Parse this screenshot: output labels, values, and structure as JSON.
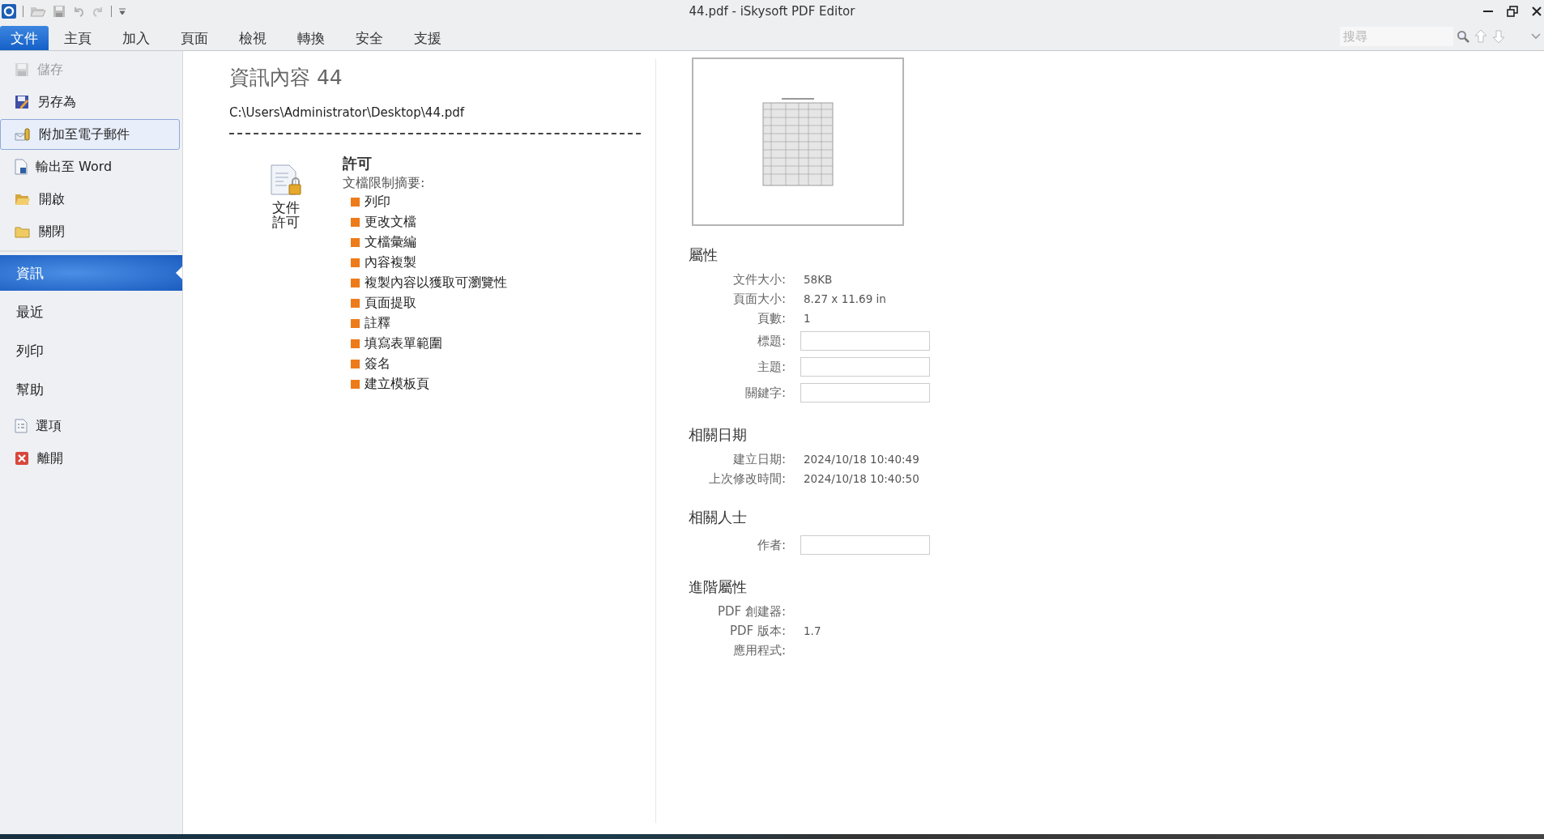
{
  "window": {
    "title": "44.pdf - iSkysoft PDF Editor"
  },
  "menu_tabs": [
    {
      "label": "文件",
      "selected": true
    },
    {
      "label": "主頁",
      "selected": false
    },
    {
      "label": "加入",
      "selected": false
    },
    {
      "label": "頁面",
      "selected": false
    },
    {
      "label": "檢視",
      "selected": false
    },
    {
      "label": "轉換",
      "selected": false
    },
    {
      "label": "安全",
      "selected": false
    },
    {
      "label": "支援",
      "selected": false
    }
  ],
  "search": {
    "placeholder": "搜尋"
  },
  "sidebar": {
    "items": [
      {
        "kind": "command",
        "label": "儲存",
        "disabled": true,
        "highlighted": false
      },
      {
        "kind": "command",
        "label": "另存為",
        "disabled": false,
        "highlighted": false
      },
      {
        "kind": "command",
        "label": "附加至電子郵件",
        "disabled": false,
        "highlighted": true
      },
      {
        "kind": "command",
        "label": "輸出至 Word",
        "disabled": false,
        "highlighted": false
      },
      {
        "kind": "command",
        "label": "開啟",
        "disabled": false,
        "highlighted": false
      },
      {
        "kind": "command",
        "label": "關閉",
        "disabled": false,
        "highlighted": false
      },
      {
        "kind": "nav",
        "label": "資訊",
        "selected": true
      },
      {
        "kind": "nav",
        "label": "最近",
        "selected": false
      },
      {
        "kind": "nav",
        "label": "列印",
        "selected": false
      },
      {
        "kind": "nav",
        "label": "幫助",
        "selected": false
      },
      {
        "kind": "command",
        "label": "選項",
        "disabled": false,
        "highlighted": false
      },
      {
        "kind": "command",
        "label": "離開",
        "disabled": false,
        "highlighted": false
      }
    ]
  },
  "info": {
    "title": "資訊內容 44",
    "path": "C:\\Users\\Administrator\\Desktop\\44.pdf",
    "permission_button": "文件許可",
    "permissions": {
      "heading": "許可",
      "subtitle": "文檔限制摘要:",
      "items": [
        "列印",
        "更改文檔",
        "文檔彙編",
        "內容複製",
        "複製內容以獲取可瀏覽性",
        "頁面提取",
        "註釋",
        "填寫表單範圍",
        "簽名",
        "建立模板頁"
      ]
    }
  },
  "properties": {
    "sections": [
      {
        "heading": "屬性",
        "rows": [
          {
            "kind": "text",
            "label": "文件大小:",
            "value": "58KB"
          },
          {
            "kind": "text",
            "label": "頁面大小:",
            "value": "8.27 x 11.69 in"
          },
          {
            "kind": "text",
            "label": "頁數:",
            "value": "1"
          },
          {
            "kind": "field",
            "label": "標題:"
          },
          {
            "kind": "field",
            "label": "主題:"
          },
          {
            "kind": "field",
            "label": "關鍵字:"
          }
        ]
      },
      {
        "heading": "相關日期",
        "rows": [
          {
            "kind": "text",
            "label": "建立日期:",
            "value": "2024/10/18 10:40:49"
          },
          {
            "kind": "text",
            "label": "上次修改時間:",
            "value": "2024/10/18 10:40:50"
          }
        ]
      },
      {
        "heading": "相關人士",
        "rows": [
          {
            "kind": "field",
            "label": "作者:"
          }
        ]
      },
      {
        "heading": "進階屬性",
        "rows": [
          {
            "kind": "text",
            "label": "PDF 創建器:"
          },
          {
            "kind": "text",
            "label": "PDF 版本:",
            "value": "1.7"
          },
          {
            "kind": "text",
            "label": "應用程式:"
          }
        ]
      }
    ]
  }
}
